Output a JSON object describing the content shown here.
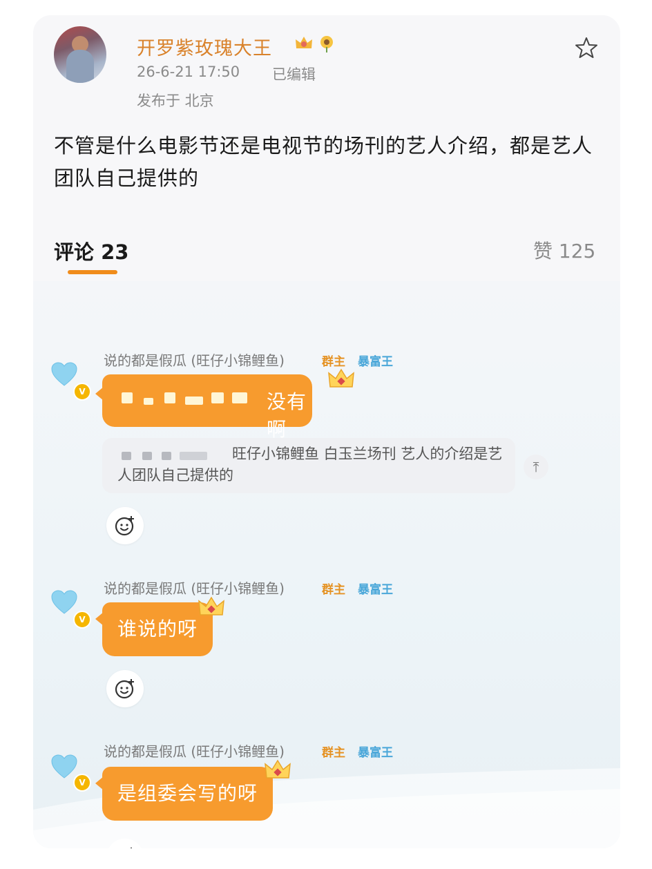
{
  "post": {
    "author_name": "开罗紫玫瑰大王",
    "time": "26-6-21 17:50",
    "edited_label": "已编辑",
    "location": "发布于 北京",
    "content": "不管是什么电影节还是电视节的场刊的艺人介绍，都是艺人团队自己提供的",
    "comments_tab": "评论 23",
    "likes": "赞 125"
  },
  "messages": [
    {
      "sender": "说的都是假瓜 (旺仔小锦鲤鱼)",
      "tag_owner": "群主",
      "tag_rich": "暴富王",
      "text": "没有啊",
      "quote": "旺仔小锦鲤鱼 白玉兰场刊 艺人的介绍是艺人团队自己提供的"
    },
    {
      "sender": "说的都是假瓜 (旺仔小锦鲤鱼)",
      "tag_owner": "群主",
      "tag_rich": "暴富王",
      "text": "谁说的呀"
    },
    {
      "sender": "说的都是假瓜 (旺仔小锦鲤鱼)",
      "tag_owner": "群主",
      "tag_rich": "暴富王",
      "text": "是组委会写的呀"
    }
  ],
  "colors": {
    "accent": "#f79b2e",
    "name": "#d9822b",
    "tab_underline": "#f08c1b",
    "rich_tag": "#4aa7d9"
  },
  "icons": [
    "star-icon",
    "heart-icon",
    "verified-icon",
    "crown-icon",
    "emoji-add-icon",
    "scroll-top-icon"
  ]
}
